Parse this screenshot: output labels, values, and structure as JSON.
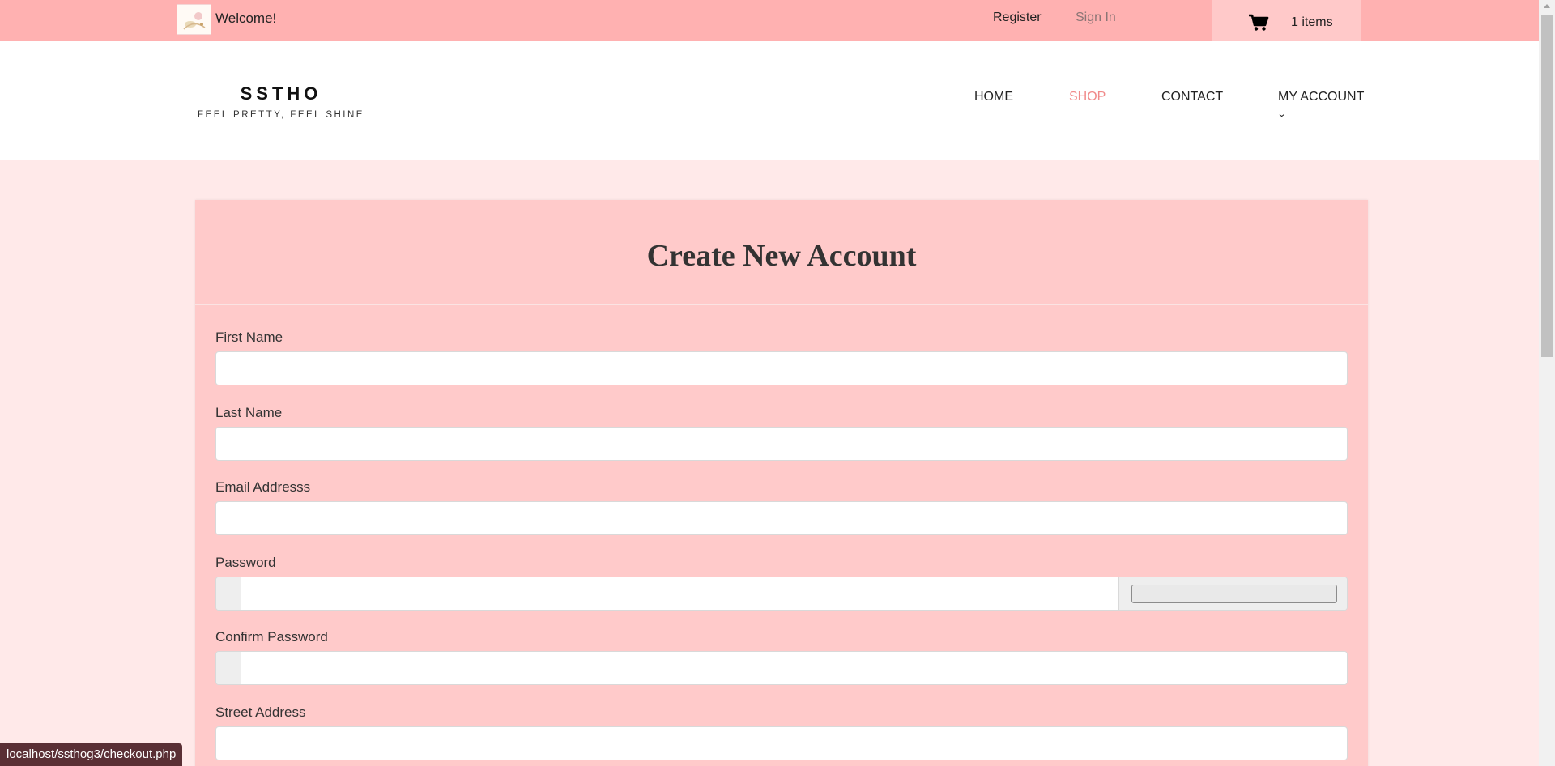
{
  "topbar": {
    "welcome": "Welcome!",
    "register": "Register",
    "sign_in": "Sign In",
    "cart_count": "1 items",
    "cart_icon": "shopping-cart-icon",
    "background_color": "#ffb1b1"
  },
  "brand": {
    "name": "SSTHO",
    "tagline": "FEEL PRETTY, FEEL SHINE"
  },
  "nav": {
    "home": "HOME",
    "shop": "SHOP",
    "contact": "CONTACT",
    "my_account": "MY ACCOUNT",
    "active_item": "SHOP",
    "active_color": "#f08a8a",
    "caret_icon": "chevron-down-icon"
  },
  "form": {
    "title": "Create New Account",
    "fields": {
      "first_name": {
        "label": "First Name",
        "value": ""
      },
      "last_name": {
        "label": "Last Name",
        "value": ""
      },
      "email": {
        "label": "Email Addresss",
        "value": ""
      },
      "password": {
        "label": "Password",
        "value": ""
      },
      "confirm_password": {
        "label": "Confirm Password",
        "value": ""
      },
      "street_address": {
        "label": "Street Address",
        "value": ""
      }
    }
  },
  "status_url": "localhost/ssthog3/checkout.php"
}
